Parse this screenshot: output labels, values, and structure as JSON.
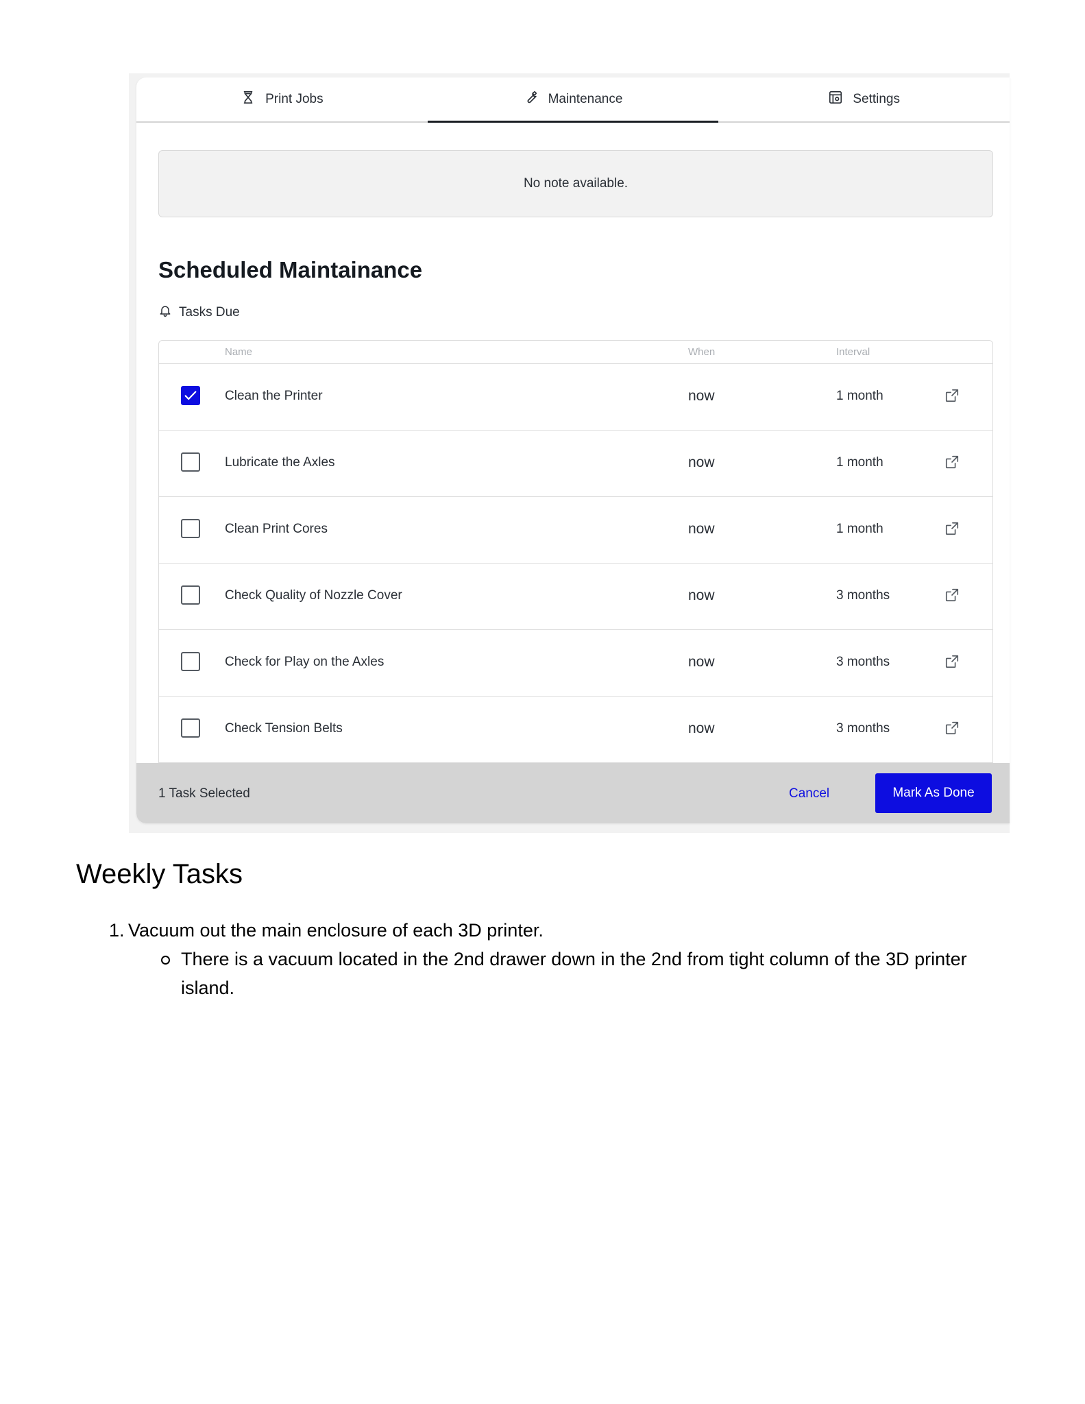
{
  "tabs": [
    {
      "label": "Print Jobs",
      "icon": "hourglass-icon"
    },
    {
      "label": "Maintenance",
      "icon": "wrench-icon"
    },
    {
      "label": "Settings",
      "icon": "settings-panel-icon"
    }
  ],
  "active_tab": "Maintenance",
  "note": "No note available.",
  "section_title": "Scheduled Maintainance",
  "tasks_due_label": "Tasks Due",
  "table": {
    "headers": {
      "name": "Name",
      "when": "When",
      "interval": "Interval"
    },
    "rows": [
      {
        "name": "Clean the Printer",
        "when": "now",
        "interval": "1 month",
        "checked": true
      },
      {
        "name": "Lubricate the Axles",
        "when": "now",
        "interval": "1 month",
        "checked": false
      },
      {
        "name": "Clean Print Cores",
        "when": "now",
        "interval": "1 month",
        "checked": false
      },
      {
        "name": "Check Quality of Nozzle Cover",
        "when": "now",
        "interval": "3 months",
        "checked": false
      },
      {
        "name": "Check for Play on the Axles",
        "when": "now",
        "interval": "3 months",
        "checked": false
      },
      {
        "name": "Check Tension Belts",
        "when": "now",
        "interval": "3 months",
        "checked": false
      }
    ]
  },
  "action_bar": {
    "selected_text": "1 Task Selected",
    "cancel_label": "Cancel",
    "done_label": "Mark As Done"
  },
  "colors": {
    "accent": "#0d0de0",
    "bar": "#d4d4d4"
  },
  "doc": {
    "heading": "Weekly Tasks",
    "items": [
      {
        "number": "1.",
        "text": "Vacuum out the main enclosure of each 3D printer.",
        "sub": [
          "There is a vacuum located in the 2nd drawer down in the 2nd from tight column of the 3D printer island."
        ]
      }
    ]
  }
}
